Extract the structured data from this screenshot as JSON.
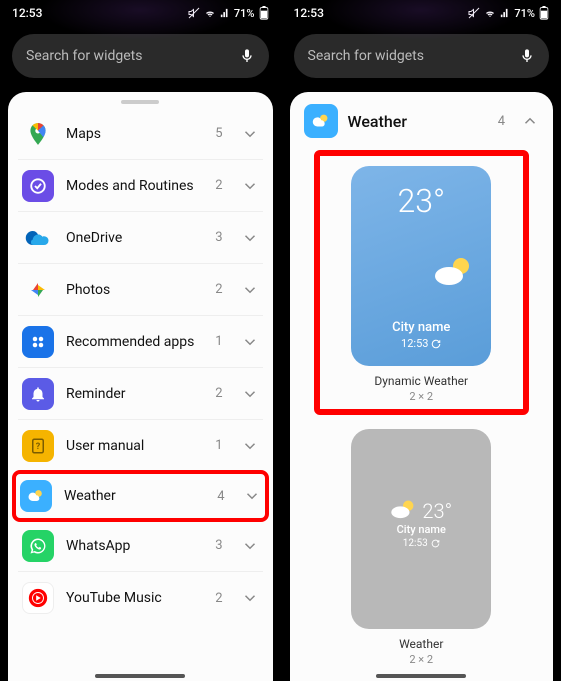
{
  "status": {
    "time": "12:53",
    "battery": "71%"
  },
  "search": {
    "placeholder": "Search for widgets"
  },
  "list": [
    {
      "name": "Maps",
      "count": "5"
    },
    {
      "name": "Modes and Routines",
      "count": "2"
    },
    {
      "name": "OneDrive",
      "count": "3"
    },
    {
      "name": "Photos",
      "count": "2"
    },
    {
      "name": "Recommended apps",
      "count": "1"
    },
    {
      "name": "Reminder",
      "count": "2"
    },
    {
      "name": "User manual",
      "count": "1"
    },
    {
      "name": "Weather",
      "count": "4"
    },
    {
      "name": "WhatsApp",
      "count": "3"
    },
    {
      "name": "YouTube Music",
      "count": "2"
    }
  ],
  "detail": {
    "title": "Weather",
    "count": "4",
    "widgets": [
      {
        "name": "Dynamic Weather",
        "size": "2 × 2",
        "temp": "23°",
        "city": "City name",
        "time": "12:53"
      },
      {
        "name": "Weather",
        "size": "2 × 2",
        "temp": "23°",
        "city": "City name",
        "time": "12:53"
      }
    ]
  }
}
